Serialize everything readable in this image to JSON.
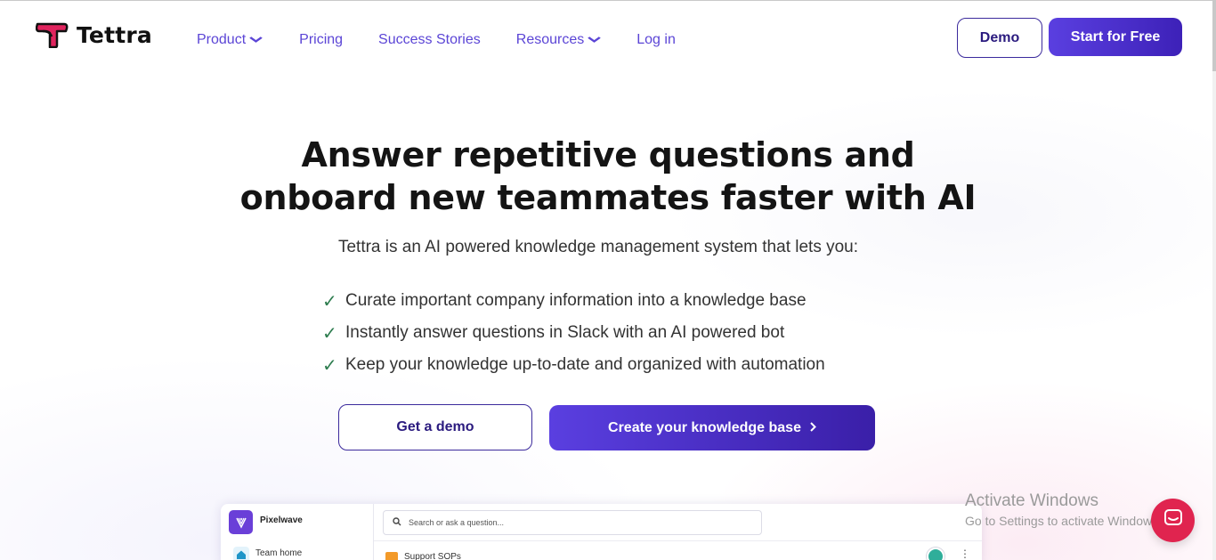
{
  "header": {
    "brand": "Tettra",
    "nav": [
      {
        "label": "Product",
        "dropdown": true
      },
      {
        "label": "Pricing",
        "dropdown": false
      },
      {
        "label": "Success Stories",
        "dropdown": false
      },
      {
        "label": "Resources",
        "dropdown": true
      },
      {
        "label": "Log in",
        "dropdown": false
      }
    ],
    "demo_label": "Demo",
    "start_label": "Start for Free"
  },
  "hero": {
    "headline_line1": "Answer repetitive questions and",
    "headline_line2": "onboard new teammates faster with AI",
    "subhead": "Tettra is an AI powered knowledge management system that lets you:",
    "check_mark": "✓",
    "bullets": [
      "Curate important company information into a knowledge base",
      "Instantly answer questions in Slack with an AI powered bot",
      "Keep your knowledge up-to-date and organized with automation"
    ],
    "get_demo_label": "Get a demo",
    "create_label": "Create your knowledge base",
    "create_chevron": "›"
  },
  "preview": {
    "workspace_name": "Pixelwave",
    "search_placeholder": "Search or ask a question...",
    "team_home_label": "Team home",
    "row_label": "Support SOPs",
    "more_icon": "⋮"
  },
  "watermark": {
    "title": "Activate Windows",
    "subtitle": "Go to Settings to activate Windows."
  },
  "colors": {
    "brand_purple": "#5a3fe0",
    "nav_link": "#5b45d6",
    "logo_pink": "#e0245e",
    "chat_red": "#e0244f",
    "check_green": "#2e7d4f"
  },
  "icons": [
    "tettra-logo-icon",
    "chevron-down-icon",
    "chevron-right-icon",
    "checkmark-icon",
    "search-icon",
    "home-icon",
    "folder-icon",
    "more-vertical-icon",
    "chat-icon"
  ]
}
